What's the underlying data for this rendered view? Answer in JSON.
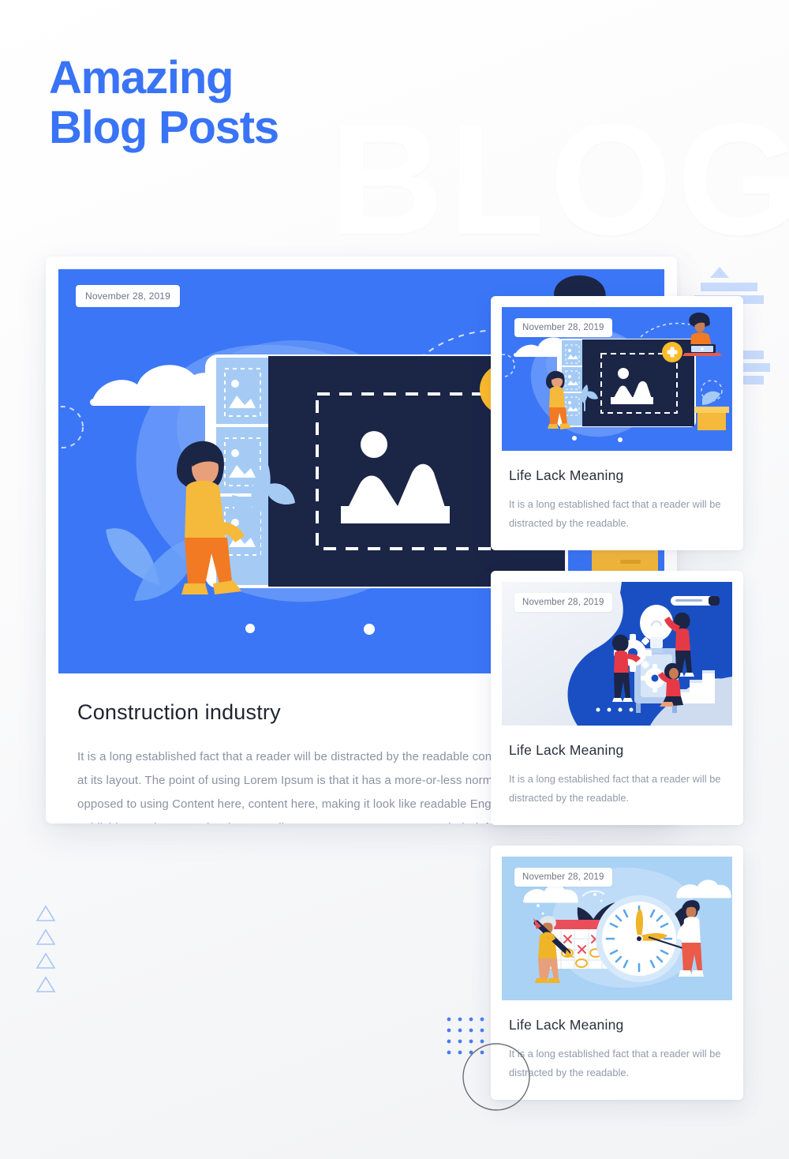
{
  "page": {
    "heading": "Amazing\nBlog Posts",
    "watermark": "BLOG",
    "accent_color": "#3973f6",
    "hero_blue": "#3b76f6",
    "body_text_color": "#8b92a5"
  },
  "featured_post": {
    "date": "November 28, 2019",
    "title": "Construction industry",
    "body": "It is a long established fact that a reader will be distracted by the readable content of a page when looking at its layout. The point of using Lorem Ipsum is that it has a more-or-less normal distribution of letters, as opposed to using Content here, content here, making it look like readable English. Many desktop publishing packages and web page editors now use Lorem Ipsum as their default model text.",
    "illustration": "image-upload-illustration"
  },
  "side_posts": [
    {
      "date": "November 28, 2019",
      "title": "Life Lack Meaning",
      "body": "It is a long established fact that a reader will be distracted by the readable.",
      "illustration": "image-upload-illustration",
      "bg": "#3b76f6"
    },
    {
      "date": "November 28, 2019",
      "title": "Life Lack Meaning",
      "body": "It is a long established fact that a reader will be distracted by the readable.",
      "illustration": "teamwork-gears-idea-illustration",
      "bg": "#eef1f6"
    },
    {
      "date": "November 28, 2019",
      "title": "Life Lack Meaning",
      "body": "It is a long established fact that a reader will be distracted by the readable.",
      "illustration": "time-management-clock-illustration",
      "bg": "#a9d2f5"
    }
  ],
  "decorations": {
    "triangles_count": 4,
    "triangle_color": "#a8c4f8",
    "dot_grid_rows": 4,
    "dot_grid_cols": 4,
    "dot_color": "#4a7cf0",
    "arc_color": "#6b6e76",
    "stripe_color": "#c5d8fb"
  }
}
